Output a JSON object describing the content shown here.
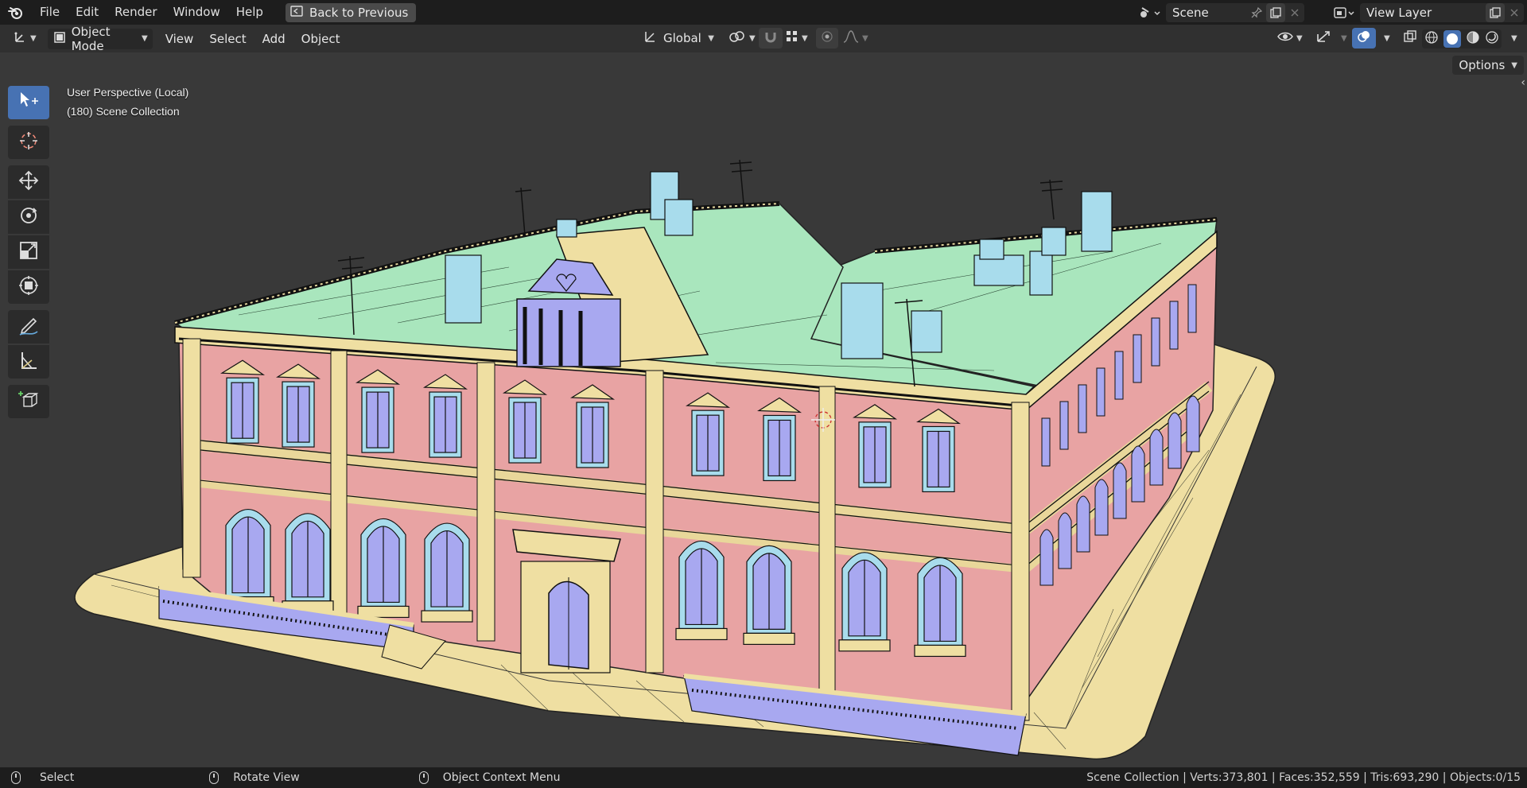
{
  "menubar": {
    "items": [
      "File",
      "Edit",
      "Render",
      "Window",
      "Help"
    ],
    "back_label": "Back to Previous",
    "scene_name": "Scene",
    "view_layer": "View Layer"
  },
  "header": {
    "mode": "Object Mode",
    "menus": [
      "View",
      "Select",
      "Add",
      "Object"
    ],
    "orientation": "Global",
    "options_label": "Options"
  },
  "viewport": {
    "perspective": "User Perspective (Local)",
    "collection": "(180) Scene Collection"
  },
  "toolbar": {
    "tools": [
      "select-box-tool",
      "cursor-tool",
      "move-tool",
      "rotate-tool",
      "scale-tool",
      "transform-tool",
      "annotate-tool",
      "measure-tool",
      "add-cube-tool"
    ],
    "active": "select-box-tool"
  },
  "statusbar": {
    "select": "Select",
    "rotate": "Rotate View",
    "context": "Object Context Menu",
    "stats": "Scene Collection | Verts:373,801 | Faces:352,559 | Tris:693,290 | Objects:0/15"
  },
  "colors": {
    "accent": "#4772b3",
    "wall": "#e8a3a3",
    "roof": "#a8e6bc",
    "ground": "#f0dfa0",
    "window": "#a8a8f0",
    "chimney": "#a8dcec"
  }
}
